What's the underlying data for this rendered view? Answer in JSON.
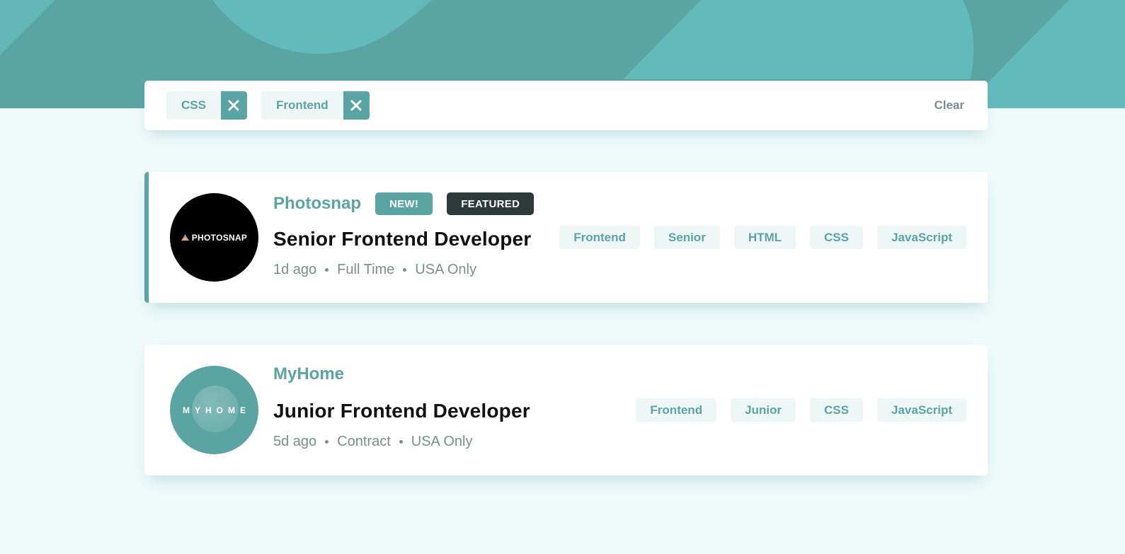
{
  "filter_bar": {
    "chips": [
      {
        "label": "CSS"
      },
      {
        "label": "Frontend"
      }
    ],
    "clear_label": "Clear"
  },
  "jobs": [
    {
      "company": "Photosnap",
      "logo_text": "PHOTOSNAP",
      "badge_new": "NEW!",
      "badge_featured": "FEATURED",
      "position": "Senior Frontend Developer",
      "posted": "1d ago",
      "contract": "Full Time",
      "location": "USA Only",
      "tags": [
        "Frontend",
        "Senior",
        "HTML",
        "CSS",
        "JavaScript"
      ]
    },
    {
      "company": "MyHome",
      "logo_text": "MYHOME",
      "position": "Junior Frontend Developer",
      "posted": "5d ago",
      "contract": "Contract",
      "location": "USA Only",
      "tags": [
        "Frontend",
        "Junior",
        "CSS",
        "JavaScript"
      ]
    }
  ],
  "colors": {
    "primary": "#5ba4a4",
    "background": "#effafa",
    "featured_badge": "#2c3a3a",
    "tag_bg": "#eef6f6",
    "muted_text": "#7b8e8e"
  },
  "icons": {
    "remove": "close-icon"
  }
}
